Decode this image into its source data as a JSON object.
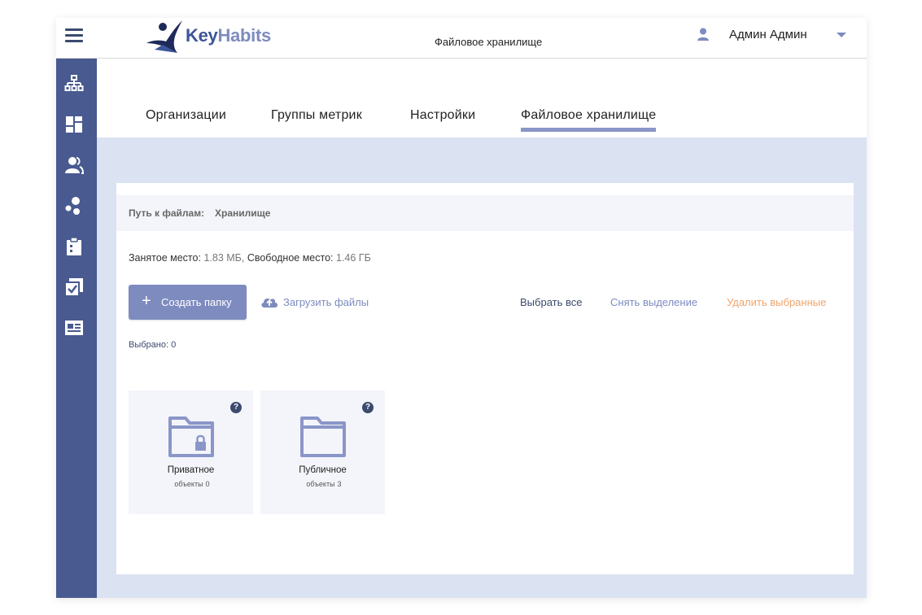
{
  "header": {
    "logo_key": "Key",
    "logo_habits": "Habits",
    "page_title": "Файловое хранилище",
    "user_name": "Админ Админ"
  },
  "sidebar": {
    "items": [
      {
        "icon": "sitemap-icon"
      },
      {
        "icon": "dashboard-icon"
      },
      {
        "icon": "users-icon"
      },
      {
        "icon": "bubbles-icon"
      },
      {
        "icon": "clipboard-icon"
      },
      {
        "icon": "checklist-icon"
      },
      {
        "icon": "id-card-icon"
      }
    ]
  },
  "tabs": [
    {
      "label": "Организации",
      "active": false
    },
    {
      "label": "Группы метрик",
      "active": false
    },
    {
      "label": "Настройки",
      "active": false
    },
    {
      "label": "Файловое хранилище",
      "active": true
    }
  ],
  "path": {
    "label": "Путь к файлам:",
    "value": "Хранилище"
  },
  "storage": {
    "used_label": "Занятое место:",
    "used_value": "1.83 МБ,",
    "free_label": "Свободное место:",
    "free_value": "1.46 ГБ"
  },
  "actions": {
    "create_folder": "Создать папку",
    "upload": "Загрузить файлы",
    "select_all": "Выбрать все",
    "deselect": "Снять выделение",
    "delete_selected": "Удалить выбранные"
  },
  "selection": {
    "label": "Выбрано: 0"
  },
  "folders": [
    {
      "name": "Приватное",
      "count_label": "объекты",
      "count": "0",
      "locked": true
    },
    {
      "name": "Публичное",
      "count_label": "объекты",
      "count": "3",
      "locked": false
    }
  ],
  "colors": {
    "sidebar": "#485a8f",
    "accent": "#7d8bbf",
    "content_bg": "#dbe2f2",
    "danger": "#f0a46b",
    "dark": "#3b4a6e"
  }
}
